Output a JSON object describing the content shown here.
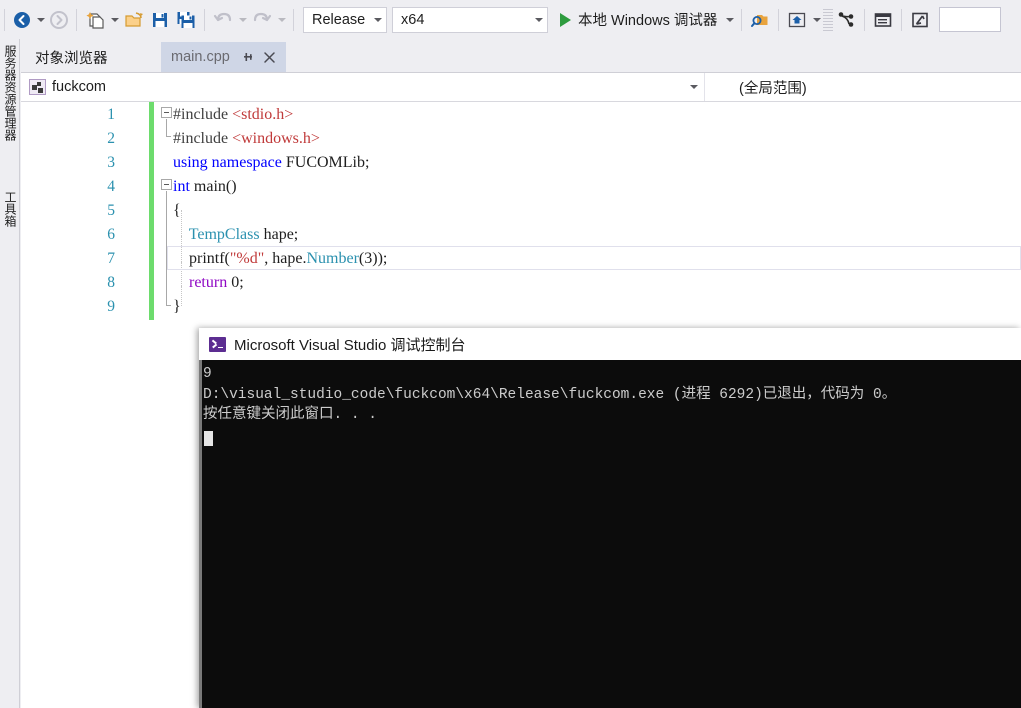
{
  "toolbar": {
    "nav_back_icon": "back-arrow-icon",
    "nav_forward_icon": "forward-arrow-icon",
    "new_item_icon": "new-item-icon",
    "open_icon": "open-file-icon",
    "save_icon": "save-icon",
    "save_all_icon": "save-all-icon",
    "undo_icon": "undo-icon",
    "redo_icon": "redo-icon",
    "configuration": "Release",
    "platform": "x64",
    "run_label": "本地 Windows 调试器",
    "run_icon": "play-icon",
    "find_in_files_icon": "find-in-files-icon",
    "home_icon": "home-icon",
    "branch_icon": "branch-icon",
    "window_icon": "window-layout-icon",
    "tool_icon": "attach-tool-icon",
    "search_value": ""
  },
  "left_rail": {
    "server_explorer": "服务器资源管理器",
    "toolbox": "工具箱"
  },
  "tabs": [
    {
      "label": "对象浏览器",
      "active": false
    },
    {
      "label": "main.cpp",
      "active": true,
      "pin_icon": "pin-icon",
      "close_icon": "close-icon"
    }
  ],
  "navbar": {
    "project": "fuckcom",
    "project_icon": "project-icon",
    "scope": "(全局范围)"
  },
  "editor": {
    "line_numbers": [
      "1",
      "2",
      "3",
      "4",
      "5",
      "6",
      "7",
      "8",
      "9"
    ],
    "lines": [
      {
        "n": 1,
        "segments": [
          {
            "t": "#include ",
            "c": "pre"
          },
          {
            "t": "<stdio.h>",
            "c": "str"
          }
        ]
      },
      {
        "n": 2,
        "segments": [
          {
            "t": "#include ",
            "c": "pre"
          },
          {
            "t": "<windows.h>",
            "c": "str"
          }
        ]
      },
      {
        "n": 3,
        "segments": [
          {
            "t": "using namespace ",
            "c": "kw"
          },
          {
            "t": "FUCOMLib;",
            "c": "id"
          }
        ]
      },
      {
        "n": 4,
        "segments": [
          {
            "t": "int",
            "c": "kw"
          },
          {
            "t": " main()",
            "c": "id"
          }
        ]
      },
      {
        "n": 5,
        "segments": [
          {
            "t": "{",
            "c": "punc"
          }
        ]
      },
      {
        "n": 6,
        "segments": [
          {
            "t": "    TempClass",
            "c": "typ"
          },
          {
            "t": " hape;",
            "c": "id"
          }
        ]
      },
      {
        "n": 7,
        "segments": [
          {
            "t": "    printf(",
            "c": "id"
          },
          {
            "t": "\"%d\"",
            "c": "str"
          },
          {
            "t": ", hape.",
            "c": "id"
          },
          {
            "t": "Number",
            "c": "fn"
          },
          {
            "t": "(3));",
            "c": "id"
          }
        ]
      },
      {
        "n": 8,
        "segments": [
          {
            "t": "    return",
            "c": "ctl"
          },
          {
            "t": " 0;",
            "c": "id"
          }
        ]
      },
      {
        "n": 9,
        "segments": [
          {
            "t": "}",
            "c": "punc"
          }
        ]
      }
    ]
  },
  "console": {
    "title": "Microsoft Visual Studio 调试控制台",
    "icon": "console-icon",
    "output_lines": [
      "9",
      "D:\\visual_studio_code\\fuckcom\\x64\\Release\\fuckcom.exe (进程 6292)已退出，代码为 0。",
      "按任意键关闭此窗口. . ."
    ]
  },
  "colors": {
    "chrome": "#eeeef2",
    "tab_active": "#cfd6e6",
    "run_green": "#2e9b3f",
    "change_bar_green": "#6ddc6d",
    "console_bg": "#0c0c0c",
    "console_text": "#cccccc",
    "keyword_blue": "#0000ff",
    "string_red": "#c03a3a",
    "type_teal": "#2b91af",
    "control_purple": "#8f08c4",
    "linenum_teal": "#2b91af"
  }
}
